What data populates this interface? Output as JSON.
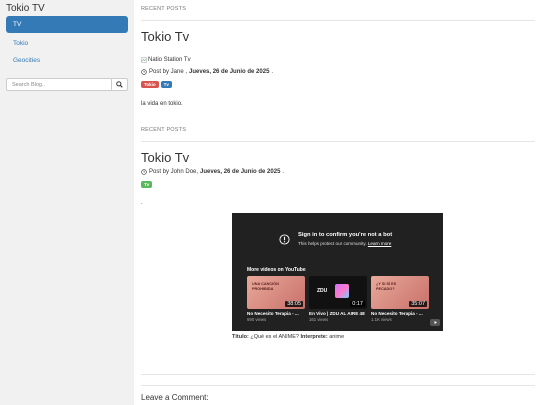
{
  "sidebar": {
    "brand": "Tokio TV",
    "items": [
      {
        "label": "TV",
        "active": true
      },
      {
        "label": "Tokio",
        "active": false
      },
      {
        "label": "Geocities",
        "active": false
      }
    ],
    "search": {
      "placeholder": "Search Blog.."
    }
  },
  "posts": [
    {
      "section_label": "RECENT POSTS",
      "title": "Tokio Tv",
      "image_alt": "Natio Station Tv",
      "posted_by_prefix": "Post by Jane , ",
      "date": "Jueves, 26 de Junio de 2025",
      "date_suffix": ".",
      "labels": [
        {
          "text": "Tokio",
          "color": "#d9534f"
        },
        {
          "text": "Tv",
          "color": "#337ab7"
        }
      ],
      "body": "la vida en tokio."
    },
    {
      "section_label": "RECENT POSTS",
      "title": "Tokio Tv",
      "posted_by_prefix": "Post by John Doe, ",
      "date": "Jueves, 26 de Junio de 2025",
      "date_suffix": ".",
      "labels": [
        {
          "text": "Tv",
          "color": "#5cb85c"
        }
      ],
      "body": "."
    }
  ],
  "youtube": {
    "alert_title": "Sign in to confirm you're not a bot",
    "alert_sub_prefix": "This helps protect our community. ",
    "alert_link": "Learn more",
    "more_videos": "More videos on YouTube",
    "videos": [
      {
        "title": "No Necesito Terapia - ...",
        "views": "690 views",
        "duration": "38:05",
        "thumb_text": "UNA CANCIÓN PROHIBIDA"
      },
      {
        "title": "En Vivo | ZDU AL AIRE 48",
        "views": "161 views",
        "duration": "0:17",
        "thumb_text": "ZDU"
      },
      {
        "title": "No Necesito Terapia - ...",
        "views": "1.1K views",
        "duration": "35:07",
        "thumb_text": "¿Y SI SÍ ES PECADO?"
      }
    ]
  },
  "caption": {
    "titulo_label": "Título:",
    "titulo_value": " ¿Qué es el ANIME? ",
    "interprete_label": "Interprete:",
    "interprete_value": " anime"
  },
  "comments": {
    "title": "Leave a Comment:"
  },
  "colors": {
    "sidebar_bg": "#f1f1f1",
    "accent": "#337ab7",
    "youtube_bg": "#212121"
  }
}
